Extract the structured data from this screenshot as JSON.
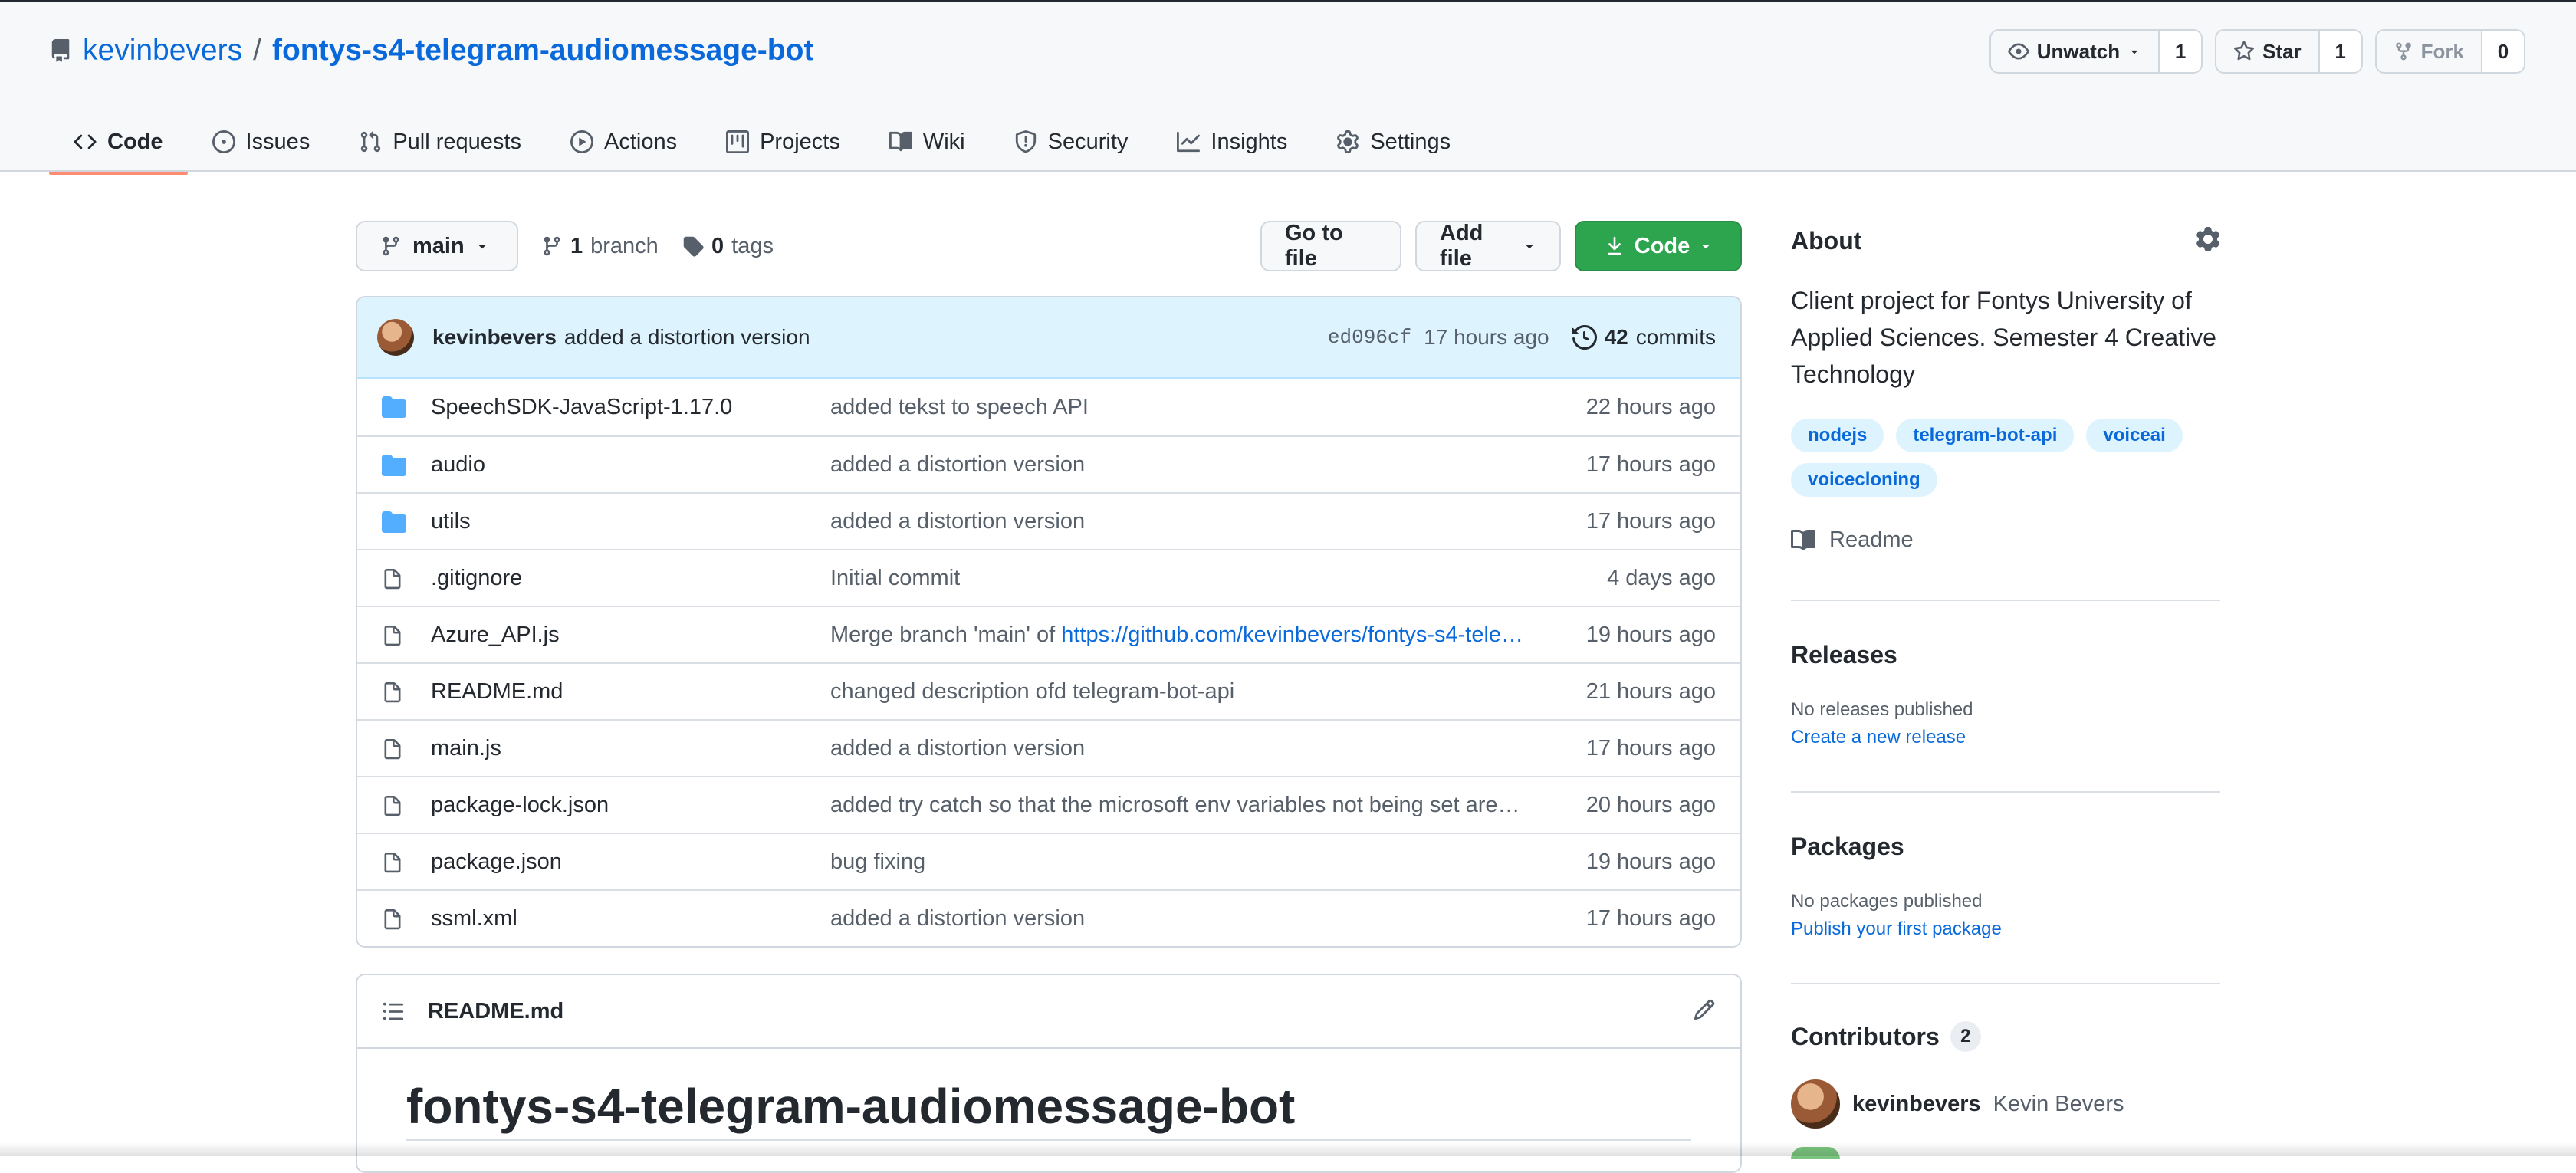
{
  "repo": {
    "owner": "kevinbevers",
    "separator": "/",
    "name": "fontys-s4-telegram-audiomessage-bot"
  },
  "header_actions": {
    "watch": {
      "label": "Unwatch",
      "count": "1"
    },
    "star": {
      "label": "Star",
      "count": "1"
    },
    "fork": {
      "label": "Fork",
      "count": "0"
    }
  },
  "tabs": [
    {
      "label": "Code",
      "icon": "code-icon",
      "selected": true
    },
    {
      "label": "Issues",
      "icon": "issue-icon"
    },
    {
      "label": "Pull requests",
      "icon": "pull-request-icon"
    },
    {
      "label": "Actions",
      "icon": "play-icon"
    },
    {
      "label": "Projects",
      "icon": "project-icon"
    },
    {
      "label": "Wiki",
      "icon": "book-icon"
    },
    {
      "label": "Security",
      "icon": "shield-icon"
    },
    {
      "label": "Insights",
      "icon": "graph-icon"
    },
    {
      "label": "Settings",
      "icon": "gear-icon"
    }
  ],
  "file_nav": {
    "branch": "main",
    "branch_count": "1",
    "branch_label": "branch",
    "tag_count": "0",
    "tag_label": "tags",
    "go_to_file": "Go to file",
    "add_file": "Add file",
    "code": "Code"
  },
  "commit": {
    "author": "kevinbevers",
    "message": "added a distortion version",
    "sha": "ed096cf",
    "time": "17 hours ago",
    "commit_count": "42",
    "commit_label": "commits"
  },
  "files": [
    {
      "type": "dir",
      "name": "SpeechSDK-JavaScript-1.17.0",
      "message": "added tekst to speech API",
      "age": "22 hours ago"
    },
    {
      "type": "dir",
      "name": "audio",
      "message": "added a distortion version",
      "age": "17 hours ago"
    },
    {
      "type": "dir",
      "name": "utils",
      "message": "added a distortion version",
      "age": "17 hours ago"
    },
    {
      "type": "file",
      "name": ".gitignore",
      "message": "Initial commit",
      "age": "4 days ago"
    },
    {
      "type": "file",
      "name": "Azure_API.js",
      "message": "Merge branch 'main' of ",
      "message_link": "https://github.com/kevinbevers/fontys-s4-tele…",
      "age": "19 hours ago"
    },
    {
      "type": "file",
      "name": "README.md",
      "message": "changed description ofd telegram-bot-api",
      "age": "21 hours ago"
    },
    {
      "type": "file",
      "name": "main.js",
      "message": "added a distortion version",
      "age": "17 hours ago"
    },
    {
      "type": "file",
      "name": "package-lock.json",
      "message": "added try catch so that the microsoft env variables not being set are…",
      "age": "20 hours ago"
    },
    {
      "type": "file",
      "name": "package.json",
      "message": "bug fixing",
      "age": "19 hours ago"
    },
    {
      "type": "file",
      "name": "ssml.xml",
      "message": "added a distortion version",
      "age": "17 hours ago"
    }
  ],
  "readme": {
    "filename": "README.md",
    "heading": "fontys-s4-telegram-audiomessage-bot"
  },
  "about": {
    "title": "About",
    "description": "Client project for Fontys University of Applied Sciences. Semester 4 Creative Technology",
    "topics": [
      "nodejs",
      "telegram-bot-api",
      "voiceai",
      "voicecloning"
    ],
    "readme_link": "Readme"
  },
  "releases": {
    "title": "Releases",
    "status": "No releases published",
    "link": "Create a new release"
  },
  "packages": {
    "title": "Packages",
    "status": "No packages published",
    "link": "Publish your first package"
  },
  "contributors": {
    "title": "Contributors",
    "count": "2",
    "first": {
      "login": "kevinbevers",
      "name": "Kevin Bevers"
    }
  },
  "colors": {
    "accent": "#0969da",
    "code_button": "#2da44e",
    "tab_underline": "#fd8c73",
    "commit_bar": "#ddf4ff"
  }
}
